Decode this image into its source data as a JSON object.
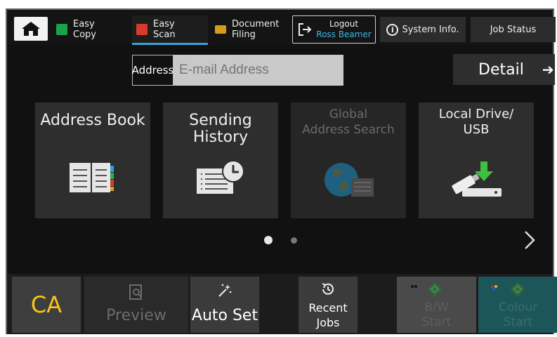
{
  "top": {
    "tabs": [
      {
        "label": "Easy\nCopy"
      },
      {
        "label": "Easy\nScan"
      },
      {
        "label": "Document\nFiling"
      }
    ],
    "logout_label": "Logout",
    "user_name": "Ross Beamer",
    "system_info": "System Info.",
    "job_status": "Job Status"
  },
  "address": {
    "label": "Address",
    "placeholder": "E-mail Address"
  },
  "detail_label": "Detail",
  "cards": [
    {
      "title": "Address Book",
      "enabled": true
    },
    {
      "title": "Sending History",
      "enabled": true
    },
    {
      "title": "Global\nAddress Search",
      "enabled": false
    },
    {
      "title": "Local Drive/\nUSB",
      "enabled": true
    }
  ],
  "pager": {
    "current": 1,
    "total": 2
  },
  "bottom": {
    "ca": "CA",
    "preview": "Preview",
    "auto_set": "Auto Set",
    "recent_jobs_1": "Recent",
    "recent_jobs_2": "Jobs",
    "bw_start_1": "B/W",
    "bw_start_2": "Start",
    "colour_start_1": "Colour",
    "colour_start_2": "Start"
  },
  "colors": {
    "accent": "#3aa0d8",
    "ca": "#f5c518",
    "user": "#39b8e6"
  }
}
